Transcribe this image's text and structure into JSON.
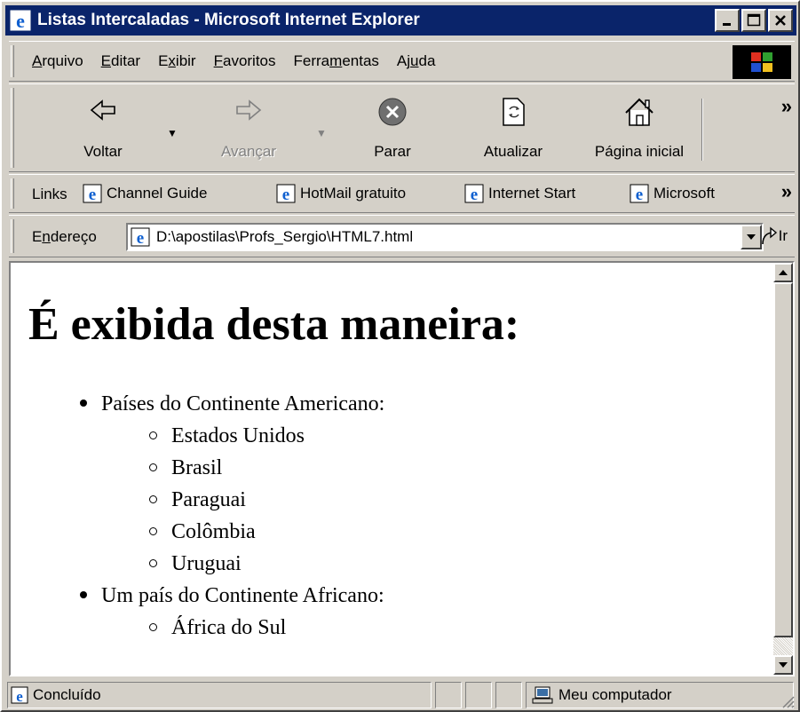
{
  "window": {
    "title": "Listas Intercaladas - Microsoft Internet Explorer"
  },
  "menu": {
    "items": [
      {
        "label": "Arquivo",
        "accel": "A",
        "rest": "rquivo",
        "pre": ""
      },
      {
        "label": "Editar",
        "accel": "E",
        "rest": "ditar",
        "pre": ""
      },
      {
        "label": "Exibir",
        "accel": "x",
        "rest": "ibir",
        "pre": "E"
      },
      {
        "label": "Favoritos",
        "accel": "F",
        "rest": "avoritos",
        "pre": ""
      },
      {
        "label": "Ferramentas",
        "accel": "m",
        "rest": "entas",
        "pre": "Ferra"
      },
      {
        "label": "Ajuda",
        "accel": "u",
        "rest": "da",
        "pre": "Aj"
      }
    ]
  },
  "toolbar": {
    "back": "Voltar",
    "forward": "Avançar",
    "stop": "Parar",
    "refresh": "Atualizar",
    "home": "Página inicial",
    "more": "»"
  },
  "links": {
    "label": "Links",
    "items": [
      "Channel Guide",
      "HotMail gratuito",
      "Internet Start",
      "Microsoft"
    ],
    "more": "»"
  },
  "address": {
    "label_pre": "E",
    "label_accel": "n",
    "label_rest": "dereço",
    "url": "D:\\apostilas\\Profs_Sergio\\HTML7.html",
    "go": "Ir"
  },
  "page": {
    "heading": "É exibida desta maneira:",
    "list": [
      {
        "text": "Países do Continente Americano:",
        "children": [
          "Estados Unidos",
          "Brasil",
          "Paraguai",
          "Colômbia",
          "Uruguai"
        ]
      },
      {
        "text": "Um país do Continente Africano:",
        "children": [
          "África do Sul"
        ]
      }
    ]
  },
  "status": {
    "text": "Concluído",
    "zone": "Meu computador"
  },
  "colors": {
    "titlebar": "#0a246a",
    "chrome": "#d4d0c8"
  }
}
